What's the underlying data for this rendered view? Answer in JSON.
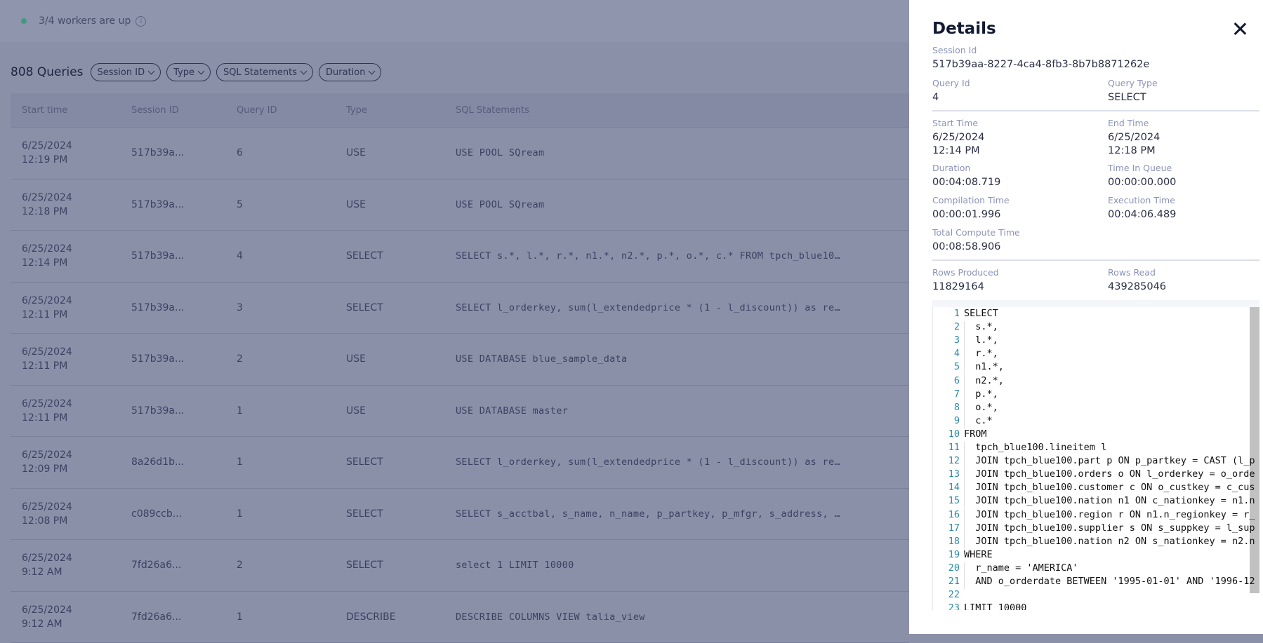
{
  "status": {
    "text": "3/4 workers are up",
    "icon": "info-icon",
    "dot_color": "#3f9b7f"
  },
  "queries": {
    "count_label": "808 Queries",
    "filters": [
      "Session ID",
      "Type",
      "SQL Statements",
      "Duration"
    ]
  },
  "table": {
    "columns": [
      "Start time",
      "Session ID",
      "Query ID",
      "Type",
      "SQL Statements"
    ],
    "rows": [
      {
        "date": "6/25/2024",
        "time": "12:19 PM",
        "session": "517b39a...",
        "query": "6",
        "type": "USE",
        "sql": "USE POOL SQream"
      },
      {
        "date": "6/25/2024",
        "time": "12:18 PM",
        "session": "517b39a...",
        "query": "5",
        "type": "USE",
        "sql": "USE POOL SQream"
      },
      {
        "date": "6/25/2024",
        "time": "12:14 PM",
        "session": "517b39a...",
        "query": "4",
        "type": "SELECT",
        "sql": "SELECT s.*, l.*, r.*, n1.*, n2.*, p.*, o.*, c.* FROM tpch_blue10…"
      },
      {
        "date": "6/25/2024",
        "time": "12:11 PM",
        "session": "517b39a...",
        "query": "3",
        "type": "SELECT",
        "sql": "SELECT l_orderkey, sum(l_extendedprice * (1 - l_discount)) as re…"
      },
      {
        "date": "6/25/2024",
        "time": "12:11 PM",
        "session": "517b39a...",
        "query": "2",
        "type": "USE",
        "sql": "USE DATABASE blue_sample_data"
      },
      {
        "date": "6/25/2024",
        "time": "12:11 PM",
        "session": "517b39a...",
        "query": "1",
        "type": "USE",
        "sql": "USE DATABASE master"
      },
      {
        "date": "6/25/2024",
        "time": "12:09 PM",
        "session": "8a26d1b...",
        "query": "1",
        "type": "SELECT",
        "sql": "SELECT l_orderkey, sum(l_extendedprice * (1 - l_discount)) as re…"
      },
      {
        "date": "6/25/2024",
        "time": "12:08 PM",
        "session": "c089ccb...",
        "query": "1",
        "type": "SELECT",
        "sql": "SELECT s_acctbal, s_name, n_name, p_partkey, p_mfgr, s_address, …"
      },
      {
        "date": "6/25/2024",
        "time": "9:12 AM",
        "session": "7fd26a6...",
        "query": "2",
        "type": "SELECT",
        "sql": "select 1 LIMIT 10000"
      },
      {
        "date": "6/25/2024",
        "time": "9:12 AM",
        "session": "7fd26a6...",
        "query": "1",
        "type": "DESCRIBE",
        "sql": "DESCRIBE COLUMNS VIEW talia_view"
      }
    ]
  },
  "details": {
    "title": "Details",
    "session_id": {
      "label": "Session Id",
      "value": "517b39aa-8227-4ca4-8fb3-8b7b8871262e"
    },
    "query_id": {
      "label": "Query Id",
      "value": "4"
    },
    "query_type": {
      "label": "Query Type",
      "value": "SELECT"
    },
    "start_time": {
      "label": "Start Time",
      "date": "6/25/2024",
      "time": "12:14 PM"
    },
    "end_time": {
      "label": "End Time",
      "date": "6/25/2024",
      "time": "12:18 PM"
    },
    "duration": {
      "label": "Duration",
      "value": "00:04:08.719"
    },
    "time_in_queue": {
      "label": "Time In Queue",
      "value": "00:00:00.000"
    },
    "compilation_time": {
      "label": "Compilation Time",
      "value": "00:00:01.996"
    },
    "execution_time": {
      "label": "Execution Time",
      "value": "00:04:06.489"
    },
    "total_compute_time": {
      "label": "Total Compute Time",
      "value": "00:08:58.906"
    },
    "rows_produced": {
      "label": "Rows Produced",
      "value": "11829164"
    },
    "rows_read": {
      "label": "Rows Read",
      "value": "439285046"
    },
    "code_lines": [
      "SELECT",
      "  s.*,",
      "  l.*,",
      "  r.*,",
      "  n1.*,",
      "  n2.*,",
      "  p.*,",
      "  o.*,",
      "  c.*",
      "FROM",
      "  tpch_blue100.lineitem l",
      "  JOIN tpch_blue100.part p ON p_partkey = CAST (l_p",
      "  JOIN tpch_blue100.orders o ON l_orderkey = o_orde",
      "  JOIN tpch_blue100.customer c ON o_custkey = c_cus",
      "  JOIN tpch_blue100.nation n1 ON c_nationkey = n1.n",
      "  JOIN tpch_blue100.region r ON n1.n_regionkey = r_",
      "  JOIN tpch_blue100.supplier s ON s_suppkey = l_sup",
      "  JOIN tpch_blue100.nation n2 ON s_nationkey = n2.n",
      "WHERE",
      "  r_name = 'AMERICA'",
      "  AND o_orderdate BETWEEN '1995-01-01' AND '1996-12",
      "",
      "LIMIT 10000"
    ]
  }
}
